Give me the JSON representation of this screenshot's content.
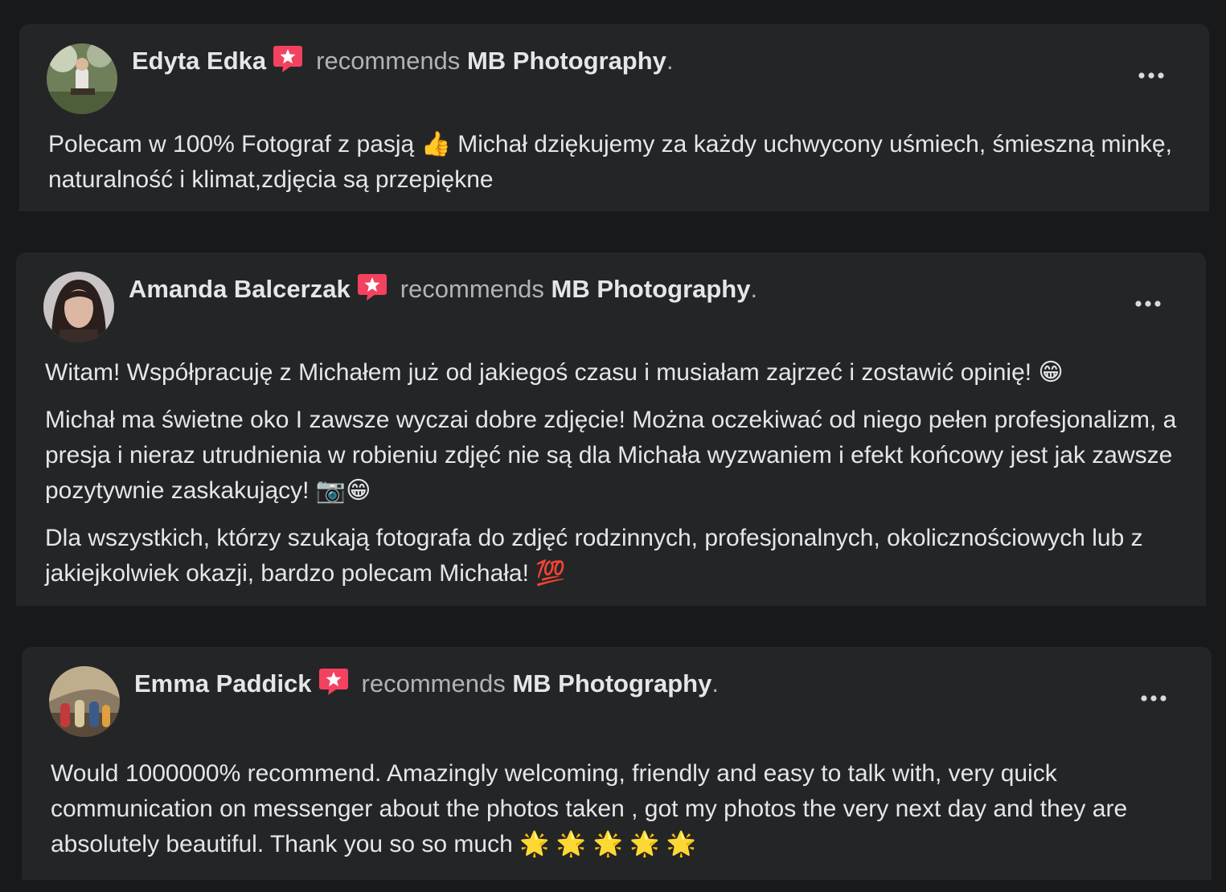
{
  "colors": {
    "page_background": "#18191a",
    "card_background": "#242526",
    "primary_text": "#e4e6eb",
    "secondary_text": "#b0b3b8",
    "badge_color": "#f3425f"
  },
  "reviews": [
    {
      "author": "Edyta Edka",
      "badge_icon": "recommendation-badge-icon",
      "verb": "recommends",
      "page": "MB Photography",
      "period": ".",
      "more_icon": "more-options-icon",
      "paragraphs": [
        "Polecam w 100% Fotograf z pasją 👍 Michał dziękujemy za każdy uchwycony uśmiech, śmieszną minkę, naturalność i klimat,zdjęcia są przepiękne"
      ]
    },
    {
      "author": "Amanda Balcerzak",
      "badge_icon": "recommendation-badge-icon",
      "verb": "recommends",
      "page": "MB Photography",
      "period": ".",
      "more_icon": "more-options-icon",
      "paragraphs": [
        "Witam! Współpracuję z Michałem już od jakiegoś czasu i musiałam zajrzeć i zostawić opinię! 😁",
        "Michał ma świetne oko I zawsze wyczai dobre zdjęcie! Można oczekiwać od niego pełen profesjonalizm, a presja i nieraz utrudnienia w robieniu zdjęć nie są dla Michała wyzwaniem i efekt końcowy jest jak zawsze pozytywnie zaskakujący! 📷😁",
        "Dla wszystkich, którzy szukają fotografa do zdjęć rodzinnych, profesjonalnych, okolicznościowych lub z jakiejkolwiek okazji, bardzo polecam Michała! 💯"
      ]
    },
    {
      "author": "Emma Paddick",
      "badge_icon": "recommendation-badge-icon",
      "verb": "recommends",
      "page": "MB Photography",
      "period": ".",
      "more_icon": "more-options-icon",
      "paragraphs": [
        "Would 1000000% recommend. Amazingly welcoming, friendly and easy to talk with, very quick communication on messenger about the photos taken , got my photos the very next day and they are absolutely beautiful. Thank you so so much 🌟 🌟 🌟 🌟 🌟"
      ]
    }
  ]
}
